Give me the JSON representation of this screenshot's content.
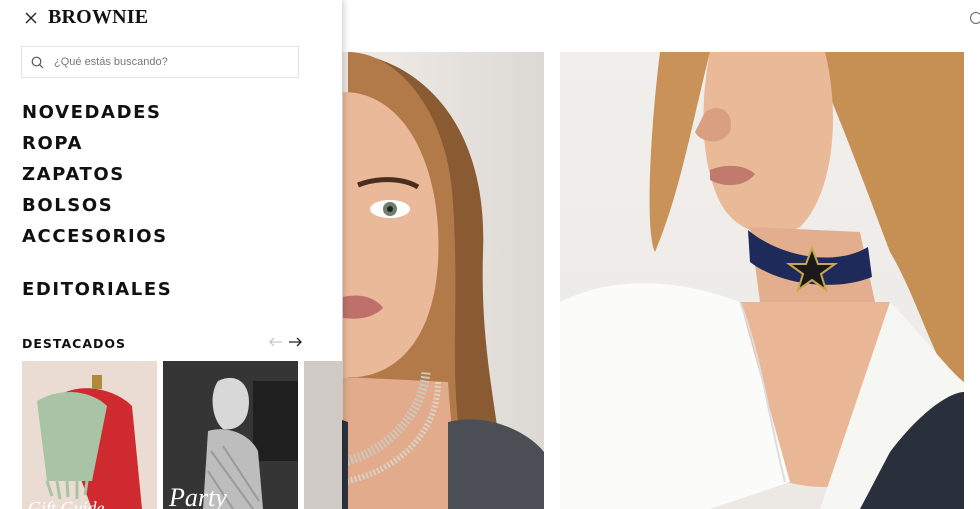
{
  "brand": "BROWNIE",
  "search": {
    "placeholder": "¿Qué estás buscando?"
  },
  "nav": {
    "items": [
      "NOVEDADES",
      "ROPA",
      "ZAPATOS",
      "BOLSOS",
      "ACCESORIOS"
    ],
    "editorial": "EDITORIALES"
  },
  "featured": {
    "title": "DESTACADOS",
    "cards": [
      {
        "caption": "Gift Guide"
      },
      {
        "caption": "Party"
      }
    ]
  },
  "icons": {
    "close": "close-icon",
    "search": "search-icon",
    "prev": "arrow-left-icon",
    "next": "arrow-right-icon"
  }
}
